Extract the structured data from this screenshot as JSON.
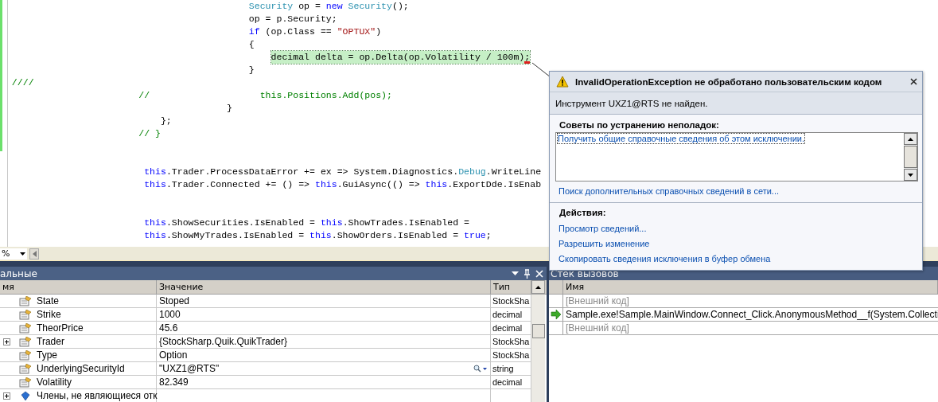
{
  "editor": {
    "lines": [
      {
        "kind": "code",
        "tokens": [
          {
            "kind": "type",
            "text": "                                             Security"
          },
          {
            "kind": "plain",
            "text": " op = "
          },
          {
            "kind": "keyword",
            "text": "new "
          },
          {
            "kind": "type",
            "text": "Security"
          },
          {
            "kind": "plain",
            "text": "();"
          }
        ]
      },
      {
        "kind": "code",
        "tokens": [
          {
            "kind": "plain",
            "text": "                                             op = p.Security;"
          }
        ]
      },
      {
        "kind": "code",
        "tokens": [
          {
            "kind": "keyword",
            "text": "                                             if"
          },
          {
            "kind": "plain",
            "text": " (op.Class == "
          },
          {
            "kind": "string",
            "text": "\"OPTUX\""
          },
          {
            "kind": "plain",
            "text": ")"
          }
        ]
      },
      {
        "kind": "code",
        "tokens": [
          {
            "kind": "plain",
            "text": "                                             {"
          }
        ]
      },
      {
        "kind": "code",
        "highlighted": true,
        "tokens": [
          {
            "kind": "plain",
            "text": "                                                 decimal delta = op.Delta(op.Volatility / 100m);"
          }
        ]
      },
      {
        "kind": "code",
        "tokens": [
          {
            "kind": "plain",
            "text": "                                             }"
          }
        ]
      },
      {
        "kind": "code",
        "tokens": [
          {
            "kind": "comment",
            "text": "  ////"
          }
        ]
      },
      {
        "kind": "code",
        "tokens": [
          {
            "kind": "comment",
            "text": "                         //                    this.Positions.Add(pos);"
          }
        ]
      },
      {
        "kind": "code",
        "tokens": [
          {
            "kind": "plain",
            "text": "                                         }"
          }
        ]
      },
      {
        "kind": "code",
        "tokens": [
          {
            "kind": "plain",
            "text": "                             };"
          }
        ]
      },
      {
        "kind": "code",
        "tokens": [
          {
            "kind": "comment",
            "text": "                         // }"
          }
        ]
      },
      {
        "kind": "blank"
      },
      {
        "kind": "blank"
      },
      {
        "kind": "code",
        "tokens": [
          {
            "kind": "keyword",
            "text": "                          this"
          },
          {
            "kind": "plain",
            "text": ".Trader.ProcessDataError += ex => System.Diagnostics."
          },
          {
            "kind": "type",
            "text": "Debug"
          },
          {
            "kind": "plain",
            "text": ".WriteLine"
          }
        ]
      },
      {
        "kind": "code",
        "tokens": [
          {
            "kind": "keyword",
            "text": "                          this"
          },
          {
            "kind": "plain",
            "text": ".Trader.Connected += () => "
          },
          {
            "kind": "keyword",
            "text": "this"
          },
          {
            "kind": "plain",
            "text": ".GuiAsync(() => "
          },
          {
            "kind": "keyword",
            "text": "this"
          },
          {
            "kind": "plain",
            "text": ".ExportDde.IsEnab"
          }
        ]
      },
      {
        "kind": "blank"
      },
      {
        "kind": "blank"
      },
      {
        "kind": "code",
        "tokens": [
          {
            "kind": "keyword",
            "text": "                          this"
          },
          {
            "kind": "plain",
            "text": ".ShowSecurities.IsEnabled = "
          },
          {
            "kind": "keyword",
            "text": "this"
          },
          {
            "kind": "plain",
            "text": ".ShowTrades.IsEnabled ="
          }
        ]
      },
      {
        "kind": "code",
        "tokens": [
          {
            "kind": "keyword",
            "text": "                          this"
          },
          {
            "kind": "plain",
            "text": ".ShowMyTrades.IsEnabled = "
          },
          {
            "kind": "keyword",
            "text": "this"
          },
          {
            "kind": "plain",
            "text": ".ShowOrders.IsEnabled = "
          },
          {
            "kind": "keyword",
            "text": "true"
          },
          {
            "kind": "plain",
            "text": ";"
          }
        ]
      }
    ],
    "zoom": "%"
  },
  "exception": {
    "title": "InvalidOperationException не обработано пользовательским кодом",
    "message": "Инструмент UXZ1@RTS не найден.",
    "tips_heading": "Советы по устранению неполадок:",
    "tips": [
      "Получить общие справочные сведения об этом исключении."
    ],
    "search_link": "Поиск дополнительных справочных сведений в сети...",
    "actions_heading": "Действия:",
    "actions": [
      "Просмотр сведений...",
      "Разрешить изменение",
      "Скопировать сведения исключения в буфер обмена"
    ]
  },
  "locals": {
    "title": "альные",
    "columns": [
      "мя",
      "Значение",
      "Тип"
    ],
    "rows": [
      {
        "name": "State",
        "value": "Stoped",
        "type": "StockSha",
        "kind": "property",
        "expandable": false
      },
      {
        "name": "Strike",
        "value": "1000",
        "type": "decimal",
        "kind": "property",
        "expandable": false
      },
      {
        "name": "TheorPrice",
        "value": "45.6",
        "type": "decimal",
        "kind": "property",
        "expandable": false
      },
      {
        "name": "Trader",
        "value": "{StockSharp.Quik.QuikTrader}",
        "type": "StockSha",
        "kind": "property",
        "expandable": true
      },
      {
        "name": "Type",
        "value": "Option",
        "type": "StockSha",
        "kind": "property",
        "expandable": false
      },
      {
        "name": "UnderlyingSecurityId",
        "value": "\"UXZ1@RTS\"",
        "type": "string",
        "kind": "property",
        "expandable": false,
        "visualizer": true
      },
      {
        "name": "Volatility",
        "value": "82.349",
        "type": "decimal",
        "kind": "property",
        "expandable": false
      },
      {
        "name": "Члены, не являющиеся отк",
        "kind": "members",
        "expandable": true
      }
    ]
  },
  "call_stack": {
    "title": "Стек вызовов",
    "columns": [
      "Имя"
    ],
    "rows": [
      {
        "text": "[Внешний код]",
        "kind": "external",
        "current": false
      },
      {
        "text": "Sample.exe!Sample.MainWindow.Connect_Click.AnonymousMethod__f(System.Collecti",
        "kind": "frame",
        "current": true
      },
      {
        "text": "[Внешний код]",
        "kind": "external",
        "current": false
      }
    ]
  }
}
